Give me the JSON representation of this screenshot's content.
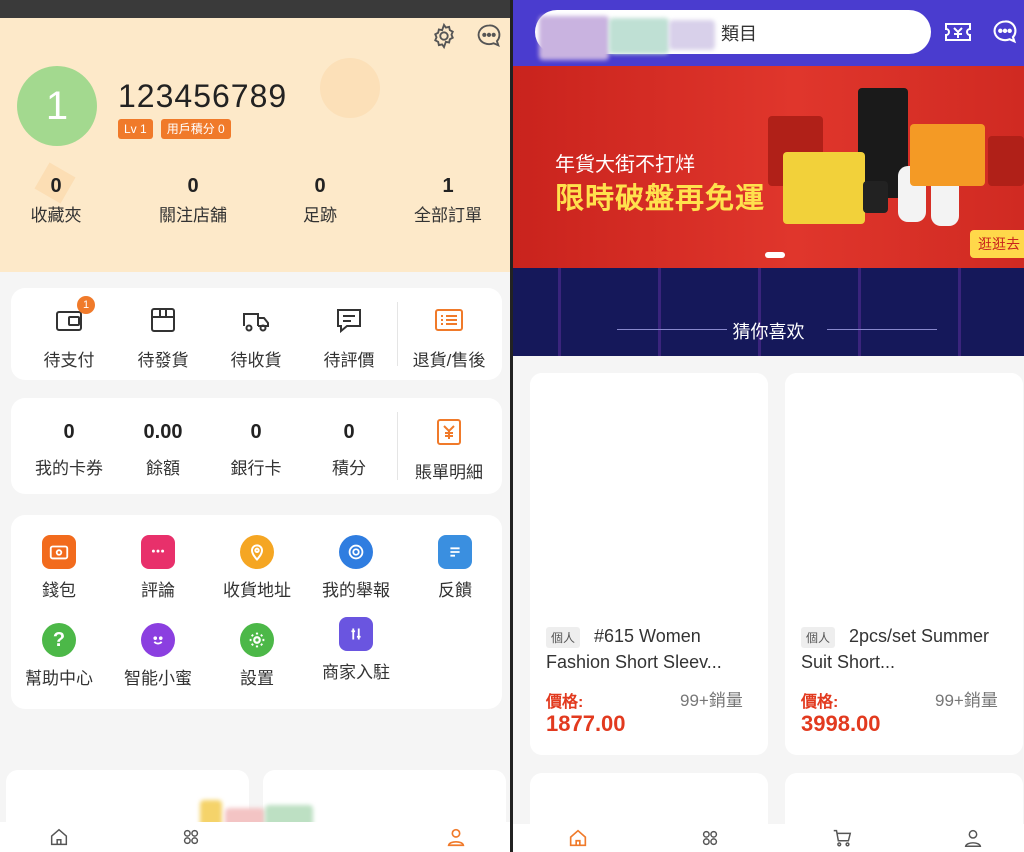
{
  "left": {
    "user": {
      "avatar_initial": "1",
      "name": "123456789",
      "level": "Lv 1",
      "points": "用戶積分 0"
    },
    "stats": [
      {
        "value": "0",
        "label": "收藏夾"
      },
      {
        "value": "0",
        "label": "關注店舖"
      },
      {
        "value": "0",
        "label": "足跡"
      },
      {
        "value": "1",
        "label": "全部訂單"
      }
    ],
    "orders": [
      {
        "label": "待支付",
        "icon": "wallet-icon",
        "badge": "1"
      },
      {
        "label": "待發貨",
        "icon": "box-icon"
      },
      {
        "label": "待收貨",
        "icon": "truck-icon"
      },
      {
        "label": "待評價",
        "icon": "comment-icon"
      },
      {
        "label": "退貨/售後",
        "icon": "return-list-icon"
      }
    ],
    "wallet": [
      {
        "value": "0",
        "label": "我的卡券"
      },
      {
        "value": "0.00",
        "label": "餘額"
      },
      {
        "value": "0",
        "label": "銀行卡"
      },
      {
        "value": "0",
        "label": "積分"
      },
      {
        "label": "賬單明細",
        "icon": "bill-icon"
      }
    ],
    "tools": [
      {
        "label": "錢包",
        "icon": "wallet-icon",
        "color": "#f26b1d"
      },
      {
        "label": "評論",
        "icon": "chat-bubble-icon",
        "color": "#e8306b"
      },
      {
        "label": "收貨地址",
        "icon": "location-pin-icon",
        "color": "#f5a623"
      },
      {
        "label": "我的舉報",
        "icon": "target-icon",
        "color": "#2f7de0"
      },
      {
        "label": "反饋",
        "icon": "document-edit-icon",
        "color": "#3a8fe0"
      },
      {
        "label": "幫助中心",
        "icon": "help-icon",
        "color": "#4cb848"
      },
      {
        "label": "智能小蜜",
        "icon": "smile-icon",
        "color": "#8b3fe0"
      },
      {
        "label": "設置",
        "icon": "gear-icon",
        "color": "#4cb848"
      },
      {
        "label": "商家入駐",
        "icon": "merchant-icon",
        "color": "#6a55e0"
      }
    ],
    "colors": {
      "accent": "#f07a2a",
      "header_bg": "#fde9c9"
    }
  },
  "right": {
    "search": {
      "category_label": "類目"
    },
    "banner": {
      "subtitle": "年貨大街不打烊",
      "headline": "限時破盤再免運",
      "cta": "逛逛去"
    },
    "section_title": "猜你喜欢",
    "products": [
      {
        "tag": "個人",
        "name": "#615 Women Fashion Short Sleev...",
        "price_label": "價格:",
        "price": "1877.00",
        "sold": "99+銷量"
      },
      {
        "tag": "個人",
        "name": "2pcs/set Summer Suit Short...",
        "price_label": "價格:",
        "price": "3998.00",
        "sold": "99+銷量"
      }
    ],
    "colors": {
      "topbar": "#4a3ccf",
      "price": "#e23a1f",
      "banner": "#d52d24"
    }
  }
}
